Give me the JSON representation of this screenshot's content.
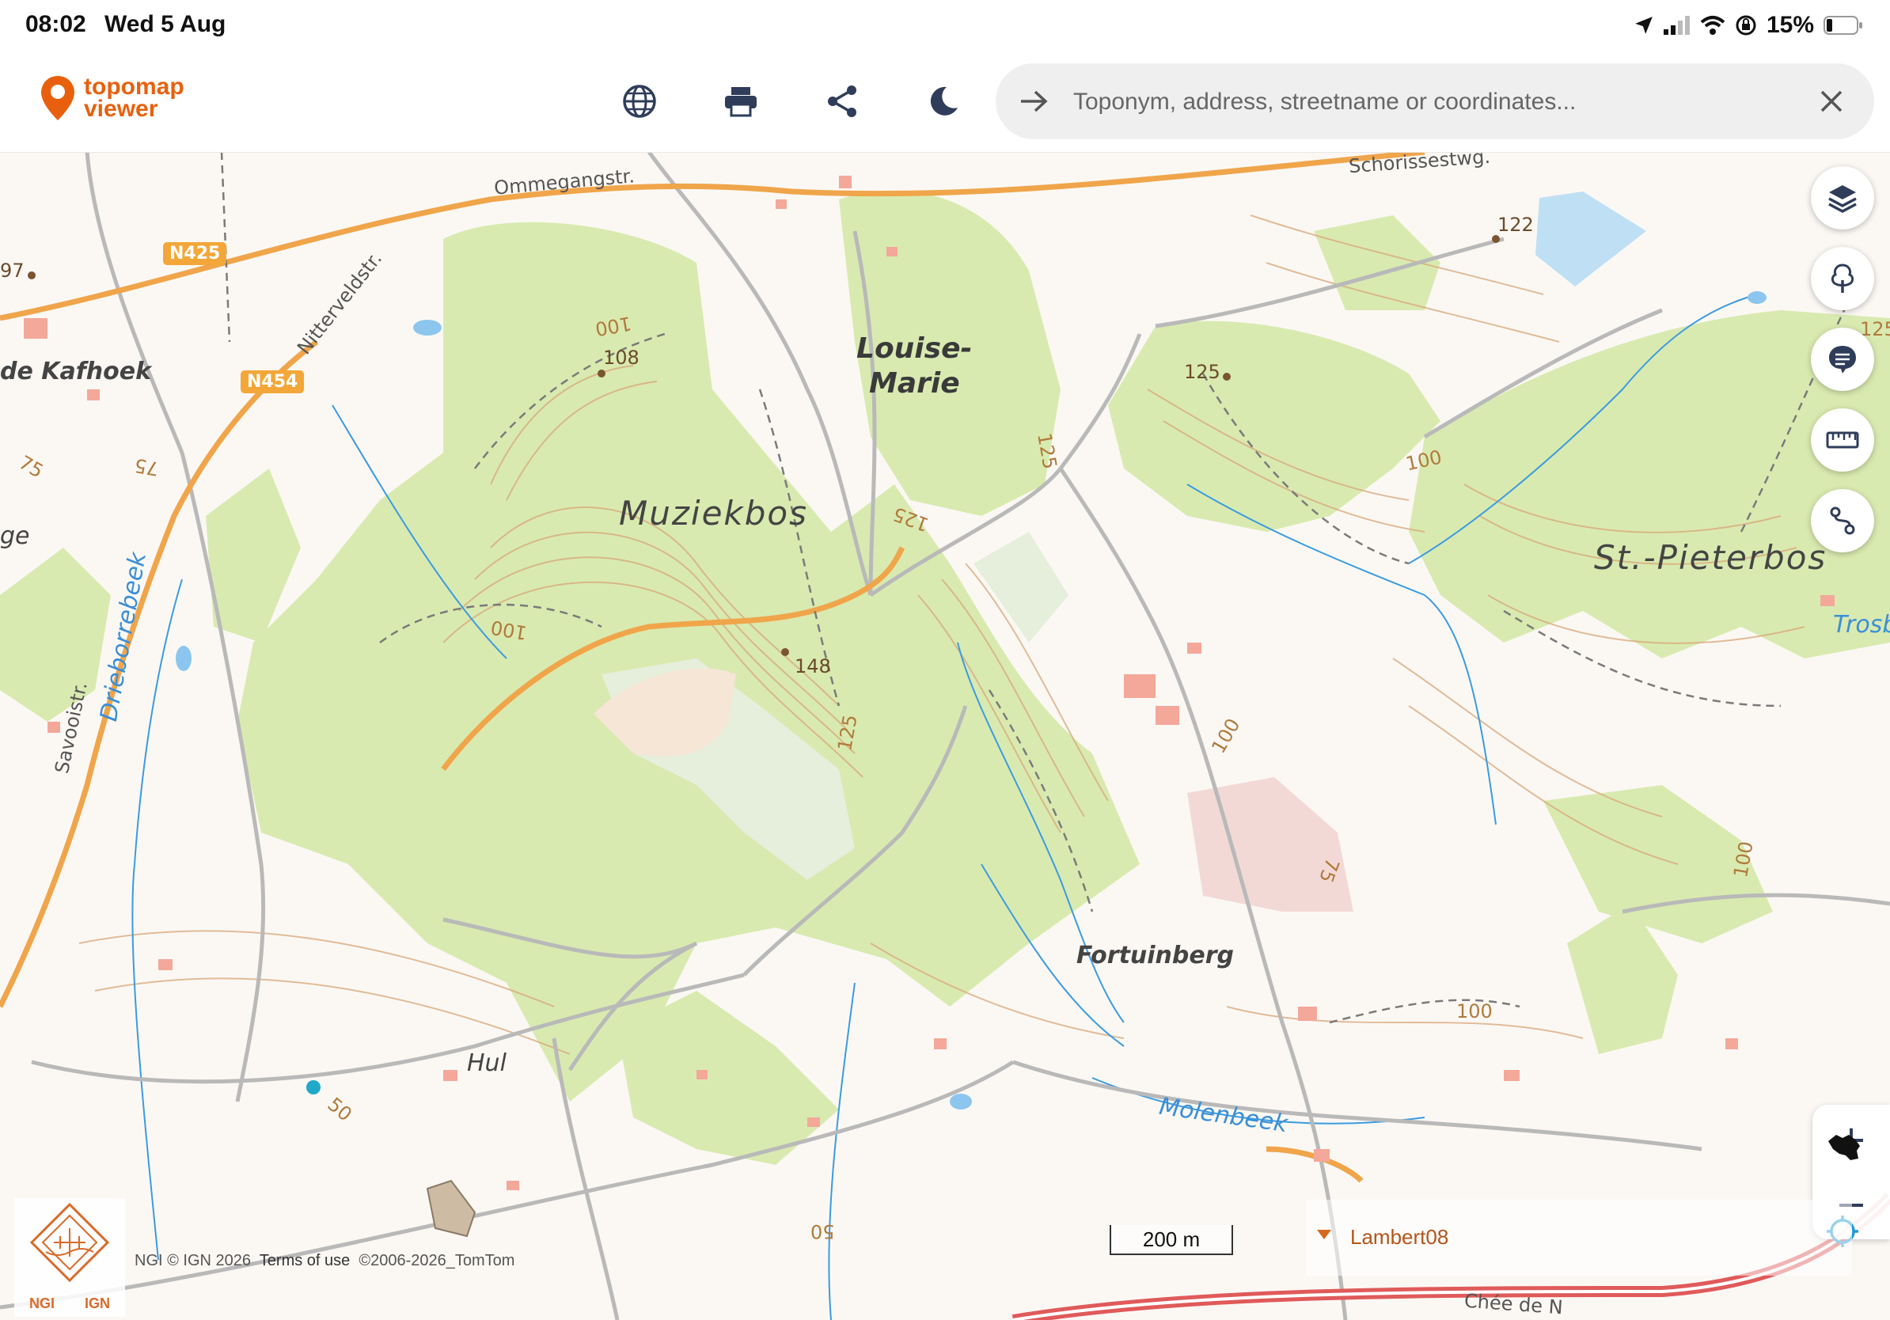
{
  "status_bar": {
    "time": "08:02",
    "date": "Wed 5 Aug",
    "battery": "15%"
  },
  "header": {
    "logo_line1": "topomap",
    "logo_line2": "viewer",
    "search_placeholder": "Toponym, address, streetname or coordinates...",
    "icons": [
      "globe-icon",
      "print-icon",
      "share-icon",
      "dark-mode-icon"
    ]
  },
  "map": {
    "place_labels": {
      "muziekbos": "Muziekbos",
      "louise_line1": "Louise-",
      "louise_line2": "Marie",
      "st_pieterbos": "St.-Pieterbos",
      "fortuinberg": "Fortuinberg",
      "hul": "Hul",
      "kafhoek": "de Kafhoek",
      "ge_partial": "ge",
      "molenbeek": "Molenbeek",
      "drieborrebeek": "Drieborrebeek",
      "trosb": "Trosb"
    },
    "road_labels": {
      "ommegangstr": "Ommegangstr.",
      "schorissestwg": "Schorissestwg.",
      "nitterveldstr": "Nitterveldstr.",
      "savooistr": "Savooistr.",
      "chee": "Chée de N"
    },
    "road_shields": {
      "n425": "N425",
      "n454": "N454"
    },
    "spot_heights": {
      "h108": "108",
      "h148": "148",
      "h125": "125",
      "h122": "122",
      "h97": "97"
    },
    "contour_labels": [
      "100",
      "125",
      "125",
      "100",
      "100",
      "125",
      "100",
      "75",
      "75",
      "75",
      "50",
      "50",
      "100",
      "100",
      "125"
    ]
  },
  "controls": {
    "right": [
      "layers-icon",
      "tree-icon",
      "comment-icon",
      "ruler-icon",
      "route-icon"
    ],
    "zoom_in": "+",
    "zoom_out": "−"
  },
  "footer": {
    "ngi_left": "NGI",
    "ngi_right": "IGN",
    "attribution_prefix": "NGI © IGN 2026",
    "terms": "Terms of use",
    "attribution_suffix": "©2006-2026_TomTom",
    "scale": "200 m",
    "crs": "Lambert08"
  },
  "colors": {
    "brand": "#e8600e",
    "forest": "#d9eab0",
    "water": "#3b8fd6",
    "road": "#f0a54a",
    "motorway": "#e05a5a"
  }
}
